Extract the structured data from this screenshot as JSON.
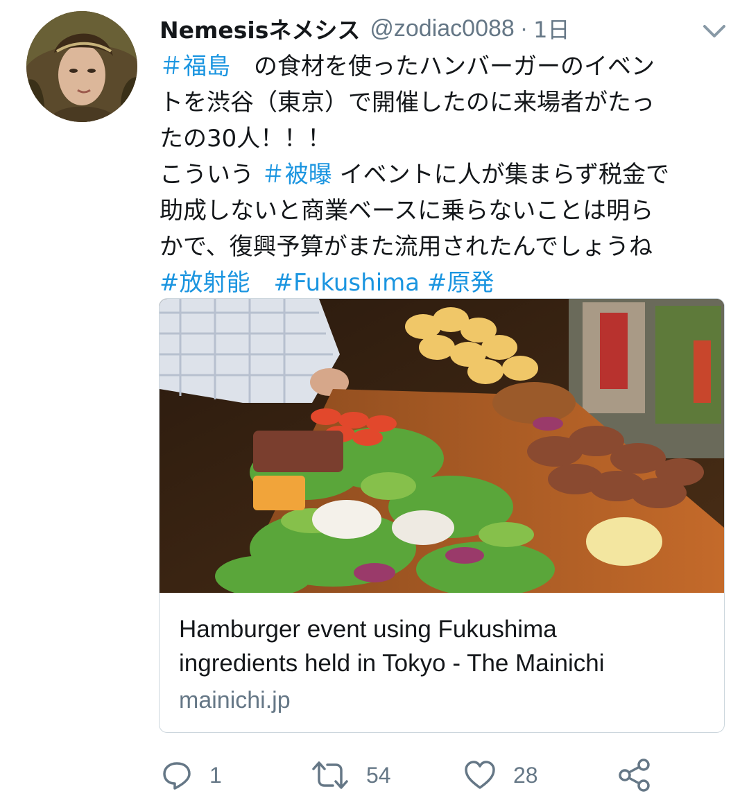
{
  "tweet": {
    "display_name": "Nemesisネメシス",
    "handle": "@zodiac0088",
    "separator": "·",
    "time": "1日",
    "text_lines": [
      {
        "tag": "＃福島",
        "rest": "　の食材を使ったハンバーガーのイベン"
      },
      {
        "text": "トを渋谷（東京）で開催したのに来場者がたっ"
      },
      {
        "text": "たの30人！！！"
      },
      {
        "pre": "こういう ",
        "tag": "＃被曝",
        "rest": " イベントに人が集まらず税金で"
      },
      {
        "text": "助成しないと商業ベースに乗らないことは明ら"
      },
      {
        "text": "かで、復興予算がまた流用されたんでしょうね"
      },
      {
        "tags": [
          "#放射能",
          "#Fukushima",
          "#原発"
        ]
      }
    ]
  },
  "card": {
    "title_line1": "Hamburger event using Fukushima",
    "title_line2": "ingredients held in Tokyo - The Mainichi",
    "domain": "mainichi.jp"
  },
  "actions": {
    "reply_count": "1",
    "retweet_count": "54",
    "like_count": "28"
  },
  "colors": {
    "link_blue": "#1b95e0",
    "secondary_text": "#657786",
    "border": "#ccd6dd"
  }
}
